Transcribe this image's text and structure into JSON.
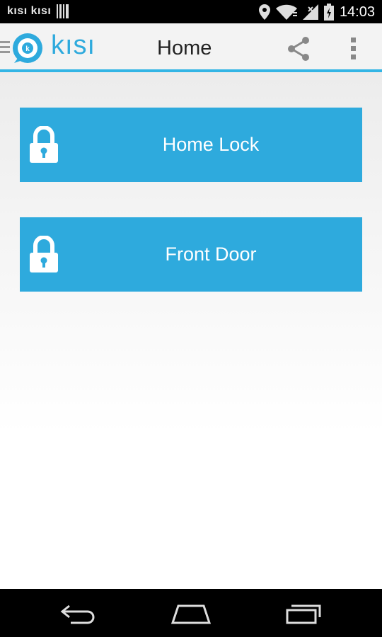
{
  "status_bar": {
    "app_labels": "kısı  kısı",
    "time": "14:03"
  },
  "action_bar": {
    "brand": "kısı",
    "title": "Home"
  },
  "locks": [
    {
      "label": "Home Lock"
    },
    {
      "label": "Front Door"
    }
  ],
  "colors": {
    "accent": "#33b5e5",
    "button": "#2eaadd"
  }
}
